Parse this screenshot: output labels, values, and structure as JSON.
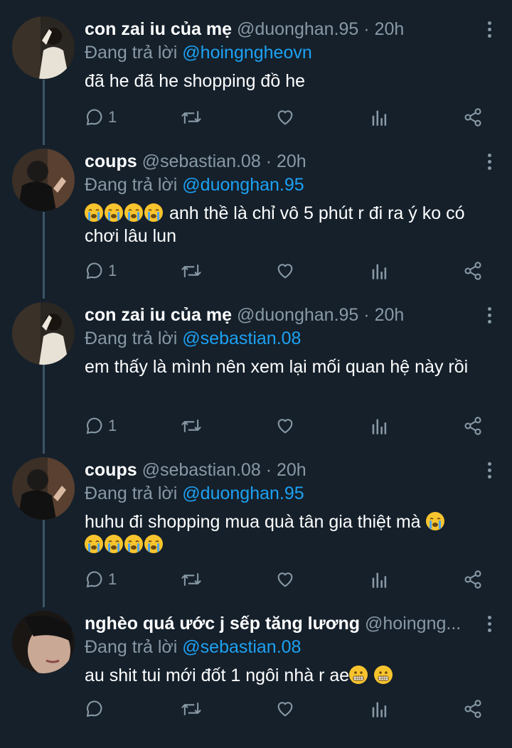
{
  "tweets": [
    {
      "name": "con zai iu của mẹ",
      "handle": "@duonghan.95",
      "time": "· 20h",
      "reply_prefix": "Đang trả lời",
      "reply_to": "@hoingngheovn",
      "text": "đã he đã he shopping đồ he",
      "reply_count": "1",
      "avatar_icon": "person-photo-avatar"
    },
    {
      "name": "coups",
      "handle": "@sebastian.08",
      "time": "· 20h",
      "reply_prefix": "Đang trả lời",
      "reply_to": "@duonghan.95",
      "text": "anh thề là chỉ vô 5 phút r đi ra ý ko có chơi lâu lun",
      "reply_count": "1",
      "avatar_icon": "person-photo-avatar"
    },
    {
      "name": "con zai iu của mẹ",
      "handle": "@duonghan.95",
      "time": "· 20h",
      "reply_prefix": "Đang trả lời",
      "reply_to": "@sebastian.08",
      "text": "em thấy là mình nên xem lại mối quan hệ này rồi",
      "reply_count": "1",
      "avatar_icon": "person-photo-avatar"
    },
    {
      "name": "coups",
      "handle": "@sebastian.08",
      "time": "· 20h",
      "reply_prefix": "Đang trả lời",
      "reply_to": "@duonghan.95",
      "text": "huhu đi shopping mua quà tân gia thiệt mà",
      "reply_count": "1",
      "avatar_icon": "person-photo-avatar"
    },
    {
      "name": "nghèo quá ước j sếp tăng lương",
      "handle": "@hoingng...",
      "time": "",
      "reply_prefix": "Đang trả lời",
      "reply_to": "@sebastian.08",
      "text": "au shit tui mới đốt 1 ngôi nhà r ae",
      "reply_count": "",
      "avatar_icon": "person-photo-avatar"
    }
  ],
  "colors": {
    "background": "#15202b",
    "secondary_text": "#8899a6",
    "mention": "#1da1f2",
    "thread_line": "#3d5466"
  }
}
